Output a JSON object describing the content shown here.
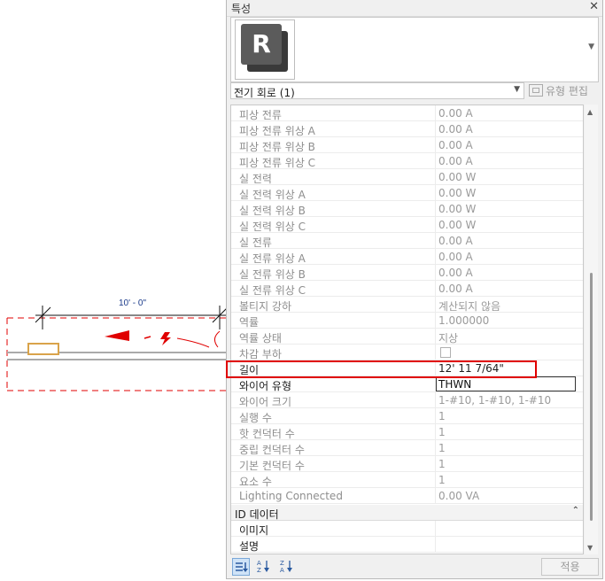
{
  "canvas": {
    "dimension_label": "10' - 0\"",
    "accent_red": "#e00000",
    "fixture_color": "#d9a34a"
  },
  "panel": {
    "title": "특성",
    "close_icon": "close-icon",
    "type_selector_icon": "revit-logo",
    "type_logo_letter": "R",
    "instance_label": "전기 회로 (1)",
    "edit_type_label": "유형 편집",
    "group_identity": "ID 데이터",
    "apply_label": "적용"
  },
  "rows": [
    {
      "name": "피상 전류",
      "value": "0.00 A"
    },
    {
      "name": "피상 전류 위상 A",
      "value": "0.00 A"
    },
    {
      "name": "피상 전류 위상 B",
      "value": "0.00 A"
    },
    {
      "name": "피상 전류 위상 C",
      "value": "0.00 A"
    },
    {
      "name": "실 전력",
      "value": "0.00 W"
    },
    {
      "name": "실 전력 위상 A",
      "value": "0.00 W"
    },
    {
      "name": "실 전력 위상 B",
      "value": "0.00 W"
    },
    {
      "name": "실 전력 위상 C",
      "value": "0.00 W"
    },
    {
      "name": "실 전류",
      "value": "0.00 A"
    },
    {
      "name": "실 전류 위상 A",
      "value": "0.00 A"
    },
    {
      "name": "실 전류 위상 B",
      "value": "0.00 A"
    },
    {
      "name": "실 전류 위상 C",
      "value": "0.00 A"
    },
    {
      "name": "볼티지 강하",
      "value": "계산되지 않음"
    },
    {
      "name": "역률",
      "value": "1.000000"
    },
    {
      "name": "역률 상태",
      "value": "지상"
    },
    {
      "name": "차감 부하",
      "value": ""
    },
    {
      "name": "길이",
      "value": "12'  11 7/64\""
    },
    {
      "name": "와이어 유형",
      "value": "THWN"
    },
    {
      "name": "와이어 크기",
      "value": "1-#10, 1-#10, 1-#10"
    },
    {
      "name": "실행 수",
      "value": "1"
    },
    {
      "name": "핫 컨덕터 수",
      "value": "1"
    },
    {
      "name": "중립 컨덕터 수",
      "value": "1"
    },
    {
      "name": "기본 컨덕터 수",
      "value": "1"
    },
    {
      "name": "요소 수",
      "value": "1"
    },
    {
      "name": "Lighting Connected",
      "value": "0.00 VA"
    }
  ],
  "identity_rows": [
    {
      "name": "이미지",
      "value": ""
    },
    {
      "name": "설명",
      "value": ""
    }
  ]
}
